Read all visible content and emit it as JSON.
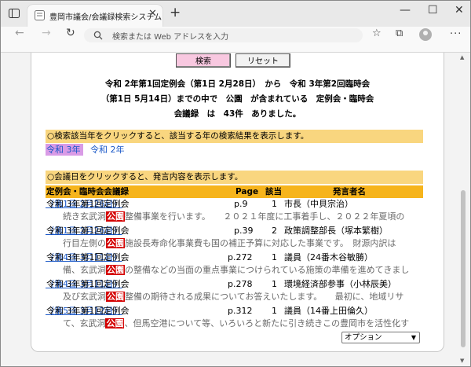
{
  "browser": {
    "tab_title": "豊岡市議会/会議録検索システム",
    "tab_close": "✕",
    "new_tab": "+",
    "window_controls": {
      "minimize": "—",
      "maximize": "☐",
      "close": "✕"
    },
    "address_placeholder": "検索または Web アドレスを入力",
    "icons": [
      "sidebar-icon",
      "back-arrow-icon",
      "forward-arrow-icon",
      "refresh-icon",
      "search-icon",
      "favorites-star-icon",
      "collections-icon",
      "profile-icon",
      "more-icon"
    ]
  },
  "form": {
    "search_button": "検索",
    "reset_button": "リセット"
  },
  "summary": {
    "line1": "令和 2年第1回定例会（第1日 2月28日）　から　令和 3年第2回臨時会",
    "line2": "（第1日 5月14日）までの中で　公園　が含まれている　定例会・臨時会",
    "line3": "会議録　は　43件　ありました。"
  },
  "year_section": {
    "instruction": "○検索該当年をクリックすると、該当する年の検索結果を表示します。",
    "years": [
      {
        "label": "令和 3年",
        "active": true
      },
      {
        "label": "令和 2年",
        "active": false
      }
    ]
  },
  "results": {
    "instruction": "○会議日をクリックすると、発言内容を表示します。",
    "headers": {
      "meeting": "定例会・臨時会会議録",
      "page": "Page",
      "hits": "該当",
      "speaker": "発言者名"
    },
    "rows": [
      {
        "meeting": "令和 3年第1回定例会",
        "date": "（第1日 2月26日）",
        "page": "p.9",
        "hits": "1",
        "speaker": "市長（中貝宗治）",
        "snippet_before": "続き玄武洞",
        "keyword": "公園",
        "snippet_after": "整備事業を行います。　　２０２１年度に工事着手し、２０２２年夏頃の"
      },
      {
        "meeting": "令和 3年第1回定例会",
        "date": "（第1日 2月26日）",
        "page": "p.39",
        "hits": "2",
        "speaker": "政策調整部長（塚本繁樹）",
        "snippet_before": "行目左側の",
        "keyword": "公園",
        "snippet_after": "施設長寿命化事業費も国の補正予算に対応した事業です。　財源内訳は"
      },
      {
        "meeting": "令和 3年第1回定例会",
        "date": "（第4日 3月11日）",
        "page": "p.272",
        "hits": "1",
        "speaker": "議員（24番木谷敏勝）",
        "snippet_before": "備、玄武洞",
        "keyword": "公園",
        "snippet_after": "の整備などの当面の重点事業につけられている施策の準備を進めてきまし"
      },
      {
        "meeting": "令和 3年第1回定例会",
        "date": "（第4日 3月11日）",
        "page": "p.278",
        "hits": "1",
        "speaker": "環境経済部参事（小林辰美）",
        "snippet_before": "及び玄武洞",
        "keyword": "公園",
        "snippet_after": "整備の期待される成果についてお答えいたします。　　最初に、地域リサ"
      },
      {
        "meeting": "令和 3年第1回定例会",
        "date": "（第5日 3月12日）",
        "page": "p.312",
        "hits": "1",
        "speaker": "議員（14番上田倫久）",
        "snippet_before": "て、玄武洞",
        "keyword": "公園",
        "snippet_after": "、但馬空港について等、いろいろと新たに引き続きこの豊岡市を活性化す"
      }
    ],
    "option_select": "オプション"
  }
}
